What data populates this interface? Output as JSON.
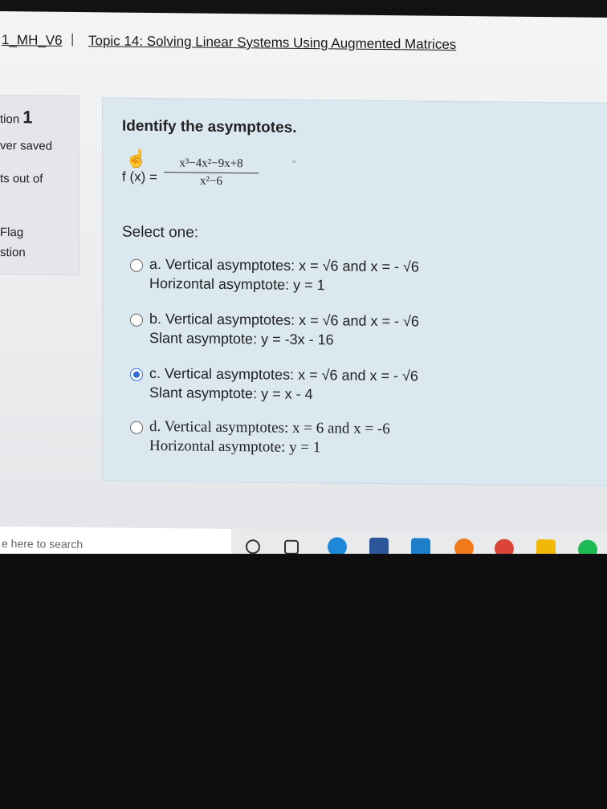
{
  "header": {
    "course": "1_MH_V6",
    "separator": "|",
    "topic": "Topic 14: Solving Linear Systems Using Augmented Matrices"
  },
  "info": {
    "question_prefix": "tion",
    "question_number": "1",
    "saved": "ver saved",
    "points": "ts out of",
    "flag": "Flag",
    "flag2": "stion"
  },
  "question": {
    "title": "Identify the asymptotes.",
    "fx": "f (x) =",
    "numerator": "x³−4x²−9x+8",
    "denominator": "x²−6",
    "select_label": "Select one:",
    "options": [
      {
        "line1": "a. Vertical asymptotes: x = √6 and x = - √6",
        "line2": "Horizontal asymptote: y = 1",
        "selected": false
      },
      {
        "line1": "b. Vertical asymptotes: x = √6  and x = - √6",
        "line2": "Slant asymptote: y = -3x - 16",
        "selected": false
      },
      {
        "line1": "c. Vertical asymptotes: x = √6  and x = - √6",
        "line2": "Slant asymptote: y = x - 4",
        "selected": true
      },
      {
        "line1": "d. Vertical asymptotes: x = 6 and x = -6",
        "line2": "Horizontal asymptote: y = 1",
        "selected": false
      }
    ]
  },
  "taskbar": {
    "search_text": "e here to search",
    "icons": [
      "cortana-icon",
      "task-view-icon",
      "edge-icon",
      "word-icon",
      "mail-icon",
      "firefox-icon",
      "chrome-icon",
      "file-explorer-icon",
      "spotify-icon"
    ]
  }
}
